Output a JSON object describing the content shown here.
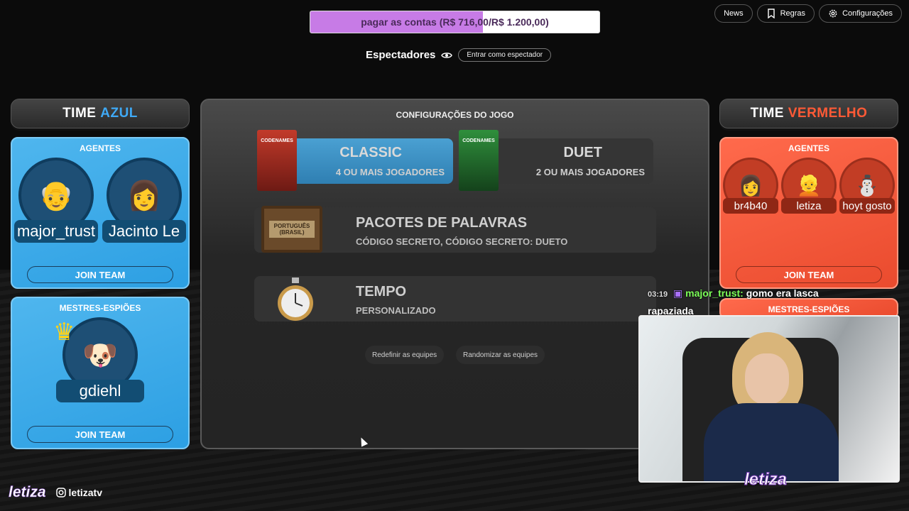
{
  "goal": {
    "text": "pagar as contas (R$ 716,00/R$ 1.200,00)",
    "current": 716,
    "target": 1200,
    "fill_color": "#c77be6"
  },
  "top_buttons": {
    "news": "News",
    "rules": "Regras",
    "settings": "Configurações"
  },
  "spectators": {
    "label": "Espectadores",
    "button": "Entrar como espectador"
  },
  "blue_team": {
    "title_prefix": "TIME ",
    "title_color_word": "AZUL",
    "agents_title": "AGENTES",
    "agents": [
      {
        "name": "major_trust"
      },
      {
        "name": "Jacinto Le"
      }
    ],
    "join_label": "JOIN TEAM",
    "spymasters_title": "MESTRES-ESPIÕES",
    "spymasters": [
      {
        "name": "gdiehl"
      }
    ],
    "join_label_2": "JOIN TEAM"
  },
  "red_team": {
    "title_prefix": "TIME ",
    "title_color_word": "VERMELHO",
    "agents_title": "AGENTES",
    "agents": [
      {
        "name": "br4b40"
      },
      {
        "name": "letiza"
      },
      {
        "name": "hoyt gosto"
      }
    ],
    "join_label": "JOIN TEAM",
    "spymasters_title": "MESTRES-ESPIÕES"
  },
  "settings": {
    "title": "CONFIGURAÇÕES DO JOGO",
    "classic": {
      "title": "CLASSIC",
      "sub": "4 OU MAIS JOGADORES",
      "box_label": "CODENAMES"
    },
    "duet": {
      "title": "DUET",
      "sub": "2 OU MAIS JOGADORES",
      "box_label": "CODENAMES"
    },
    "packs": {
      "title": "PACOTES DE PALAVRAS",
      "sub": "CÓDIGO SECRETO, CÓDIGO SECRETO: DUETO",
      "sign_label": "PORTUGUÊS (BRASIL)"
    },
    "timer": {
      "title": "TEMPO",
      "sub": "PERSONALIZADO"
    },
    "reset_teams": "Redefinir as equipes",
    "randomize_teams": "Randomizar as equipes"
  },
  "chat": {
    "time": "03:19",
    "user": "major_trust:",
    "message": "gomo era lasca",
    "message_2": "rapaziada"
  },
  "webcam": {
    "tag": "letiza"
  },
  "brand": {
    "logo": "letiza",
    "instagram": "letizatv"
  },
  "colors": {
    "blue": "#3fa9f5",
    "red": "#ff5a36",
    "chat_user": "#7cff58"
  }
}
